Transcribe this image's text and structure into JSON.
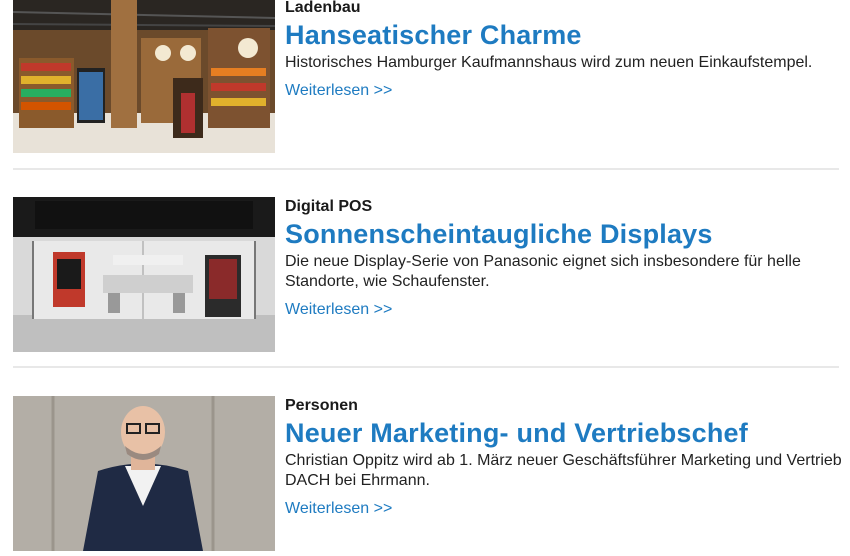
{
  "articles": [
    {
      "category": "Ladenbau",
      "headline": "Hanseatischer Charme",
      "teaser": "Historisches Hamburger Kaufmannshaus wird zum neuen Einkaufstempel.",
      "link_label": "Weiterlesen >>"
    },
    {
      "category": "Digital POS",
      "headline": "Sonnenscheintaugliche Displays",
      "teaser": "Die neue Display-Serie von Panasonic eignet sich insbesondere für helle Standorte, wie Schaufenster.",
      "link_label": "Weiterlesen >>"
    },
    {
      "category": "Personen",
      "headline": "Neuer Marketing- und Vertriebschef",
      "teaser": "Christian Oppitz wird ab 1. März neuer Geschäftsführer Marketing und Vertrieb DACH bei Ehrmann.",
      "link_label": "Weiterlesen >>"
    }
  ],
  "colors": {
    "accent": "#1e7bc1",
    "text": "#222222",
    "divider": "#e8e8e8"
  }
}
